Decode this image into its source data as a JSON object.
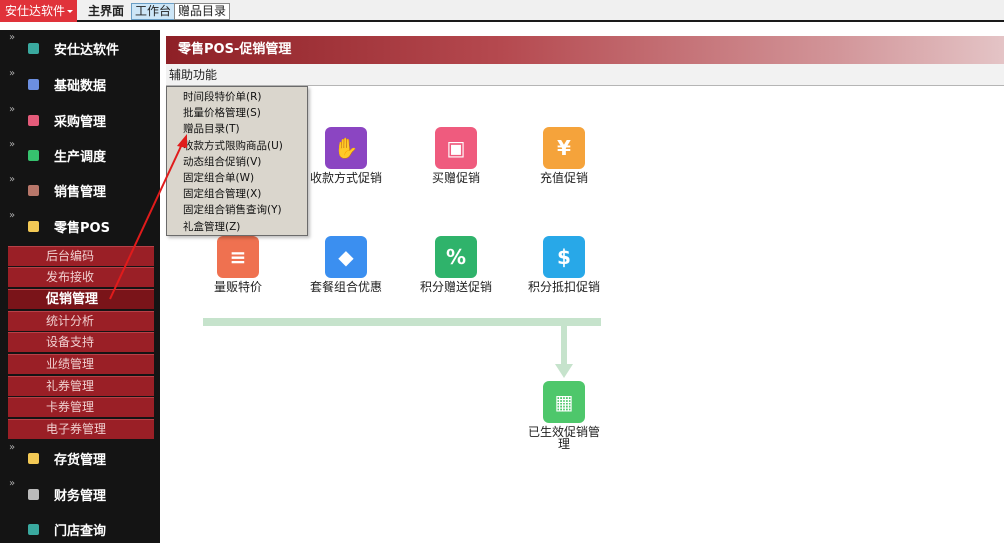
{
  "topbar": {
    "brand": "安仕达软件",
    "tabs": [
      "主界面",
      "工作台",
      "赠品目录"
    ]
  },
  "sidebar": {
    "items": [
      {
        "label": "安仕达软件",
        "icon": "teal-square-icon",
        "color": "#3aa99f"
      },
      {
        "label": "基础数据",
        "icon": "blue-square-icon",
        "color": "#6c8fe0"
      },
      {
        "label": "采购管理",
        "icon": "pink-square-icon",
        "color": "#e45b7a"
      },
      {
        "label": "生产调度",
        "icon": "green-square-icon",
        "color": "#36c26e"
      },
      {
        "label": "销售管理",
        "icon": "brown-square-icon",
        "color": "#b8776a"
      },
      {
        "label": "零售POS",
        "icon": "yellow-square-icon",
        "color": "#f3c955"
      }
    ],
    "pos_sub": [
      "后台编码",
      "发布接收",
      "促销管理",
      "统计分析",
      "设备支持",
      "业绩管理",
      "礼券管理",
      "卡券管理",
      "电子券管理"
    ],
    "active_sub": "促销管理",
    "bottom_items": [
      {
        "label": "存货管理",
        "icon": "yellow-square-icon",
        "color": "#f3c955"
      },
      {
        "label": "财务管理",
        "icon": "gray-square-icon",
        "color": "#bbbbbb"
      },
      {
        "label": "门店查询",
        "icon": "teal-square-icon",
        "color": "#3aa99f"
      }
    ]
  },
  "panel": {
    "title": "零售POS-促销管理",
    "menu": "辅助功能"
  },
  "dropdown": {
    "items": [
      "时间段特价单(R)",
      "批量价格管理(S)",
      "赠品目录(T)",
      "收款方式限购商品(U)",
      "动态组合促销(V)",
      "固定组合单(W)",
      "固定组合管理(X)",
      "固定组合销售查询(Y)",
      "礼盒管理(Z)"
    ]
  },
  "tiles": [
    {
      "label": "收款方式促销",
      "icon": "hand-coin-icon",
      "color": "#8b45c2",
      "glyph": "✋"
    },
    {
      "label": "买赠促销",
      "icon": "gift-icon",
      "color": "#ef5b7e",
      "glyph": "🎁"
    },
    {
      "label": "充值促销",
      "icon": "coins-card-icon",
      "color": "#f5a33b",
      "glyph": "¥"
    },
    {
      "label": "量贩特价",
      "icon": "database-icon",
      "color": "#ef7150",
      "glyph": "≡"
    },
    {
      "label": "套餐组合优惠",
      "icon": "cubes-icon",
      "color": "#3b8ff0",
      "glyph": "◆"
    },
    {
      "label": "积分赠送促销",
      "icon": "percent-badge-icon",
      "color": "#2fb36b",
      "glyph": "%"
    },
    {
      "label": "积分抵扣促销",
      "icon": "cash-hand-icon",
      "color": "#28a8e8",
      "glyph": "$"
    },
    {
      "label": "已生效促销管理",
      "icon": "calendar-clock-icon",
      "color": "#4ec76b",
      "glyph": "▦"
    }
  ]
}
